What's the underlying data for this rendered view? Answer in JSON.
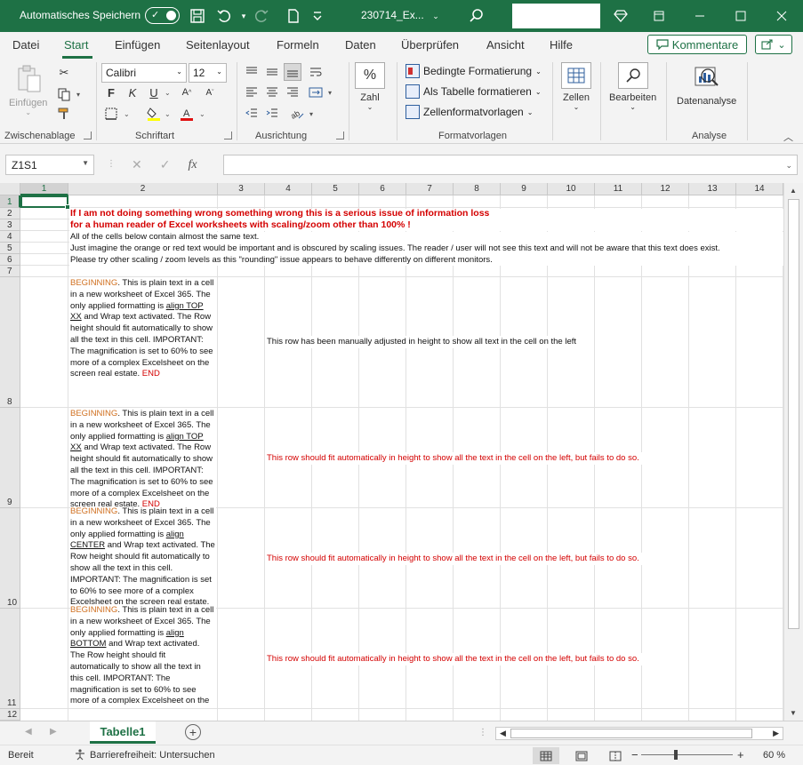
{
  "titlebar": {
    "autosave_label": "Automatisches Speichern",
    "filename": "230714_Ex...",
    "colors": {
      "bg": "#1e7145"
    }
  },
  "tabs": [
    "Datei",
    "Start",
    "Einfügen",
    "Seitenlayout",
    "Formeln",
    "Daten",
    "Überprüfen",
    "Ansicht",
    "Hilfe"
  ],
  "active_tab": "Start",
  "comments_label": "Kommentare",
  "ribbon": {
    "paste_label": "Einfügen",
    "clipboard_group": "Zwischenablage",
    "font_name": "Calibri",
    "font_size": "12",
    "bold": "F",
    "italic": "K",
    "underline": "U",
    "font_group": "Schriftart",
    "align_group": "Ausrichtung",
    "number_label": "Zahl",
    "number_symbol": "%",
    "cond_format": "Bedingte Formatierung",
    "as_table": "Als Tabelle formatieren",
    "cell_styles": "Zellenformatvorlagen",
    "styles_group": "Formatvorlagen",
    "cells_label": "Zellen",
    "edit_label": "Bearbeiten",
    "analysis_label": "Datenanalyse",
    "analysis_group": "Analyse"
  },
  "formula_bar": {
    "name_box": "Z1S1",
    "fx": "fx",
    "value": ""
  },
  "columns": [
    "1",
    "2",
    "3",
    "4",
    "5",
    "6",
    "7",
    "8",
    "9",
    "10",
    "11",
    "12",
    "13",
    "14"
  ],
  "rows": [
    "1",
    "2",
    "3",
    "4",
    "5",
    "6",
    "7",
    "8",
    "9",
    "10",
    "11",
    "12"
  ],
  "cells": {
    "r2": "If I am not doing something wrong something wrong this is a serious issue of information loss",
    "r3": "for a human reader of Excel worksheets with scaling/zoom other than 100% !",
    "r4": "All of the cells below contain almost the same text.",
    "r5": "Just imagine the orange or red text would be important and is obscured by scaling issues. The reader / user will not see this text and will not be aware that this text does exist.",
    "r6": "Please try other scaling / zoom levels as this \"rounding\" issue appears to behave differently on different monitors.",
    "wrap_begin": "BEGINNING",
    "wrap_a": ". This is plain text in a cell in a new worksheet of Excel 365. The only applied formatting is ",
    "wrap_b": " and Wrap text activated. The Row height should fit automatically to show all the text in this cell. IMPORTANT: The magnification is set to 60% to see more of a complex Excelsheet on the screen real estate. ",
    "wrap_end": "END",
    "align_top": "align TOP XX",
    "align_center": "align CENTER",
    "align_bottom": "align BOTTOM",
    "r8_note": "This row has been manually adjusted in height to show all text in the cell on the left",
    "r9_note": "This row should fit automatically in height to show all the text in the cell on the left, but fails to do so.",
    "r10_note": "This row should fit automatically in height to show all the text in the cell on the left, but fails to do so.",
    "r11_note": "This row should fit automatically in height to show all the text in the cell on the left, but fails to do so."
  },
  "sheet_tab": "Tabelle1",
  "status": {
    "ready": "Bereit",
    "accessibility": "Barrierefreiheit: Untersuchen",
    "zoom": "60 %"
  }
}
